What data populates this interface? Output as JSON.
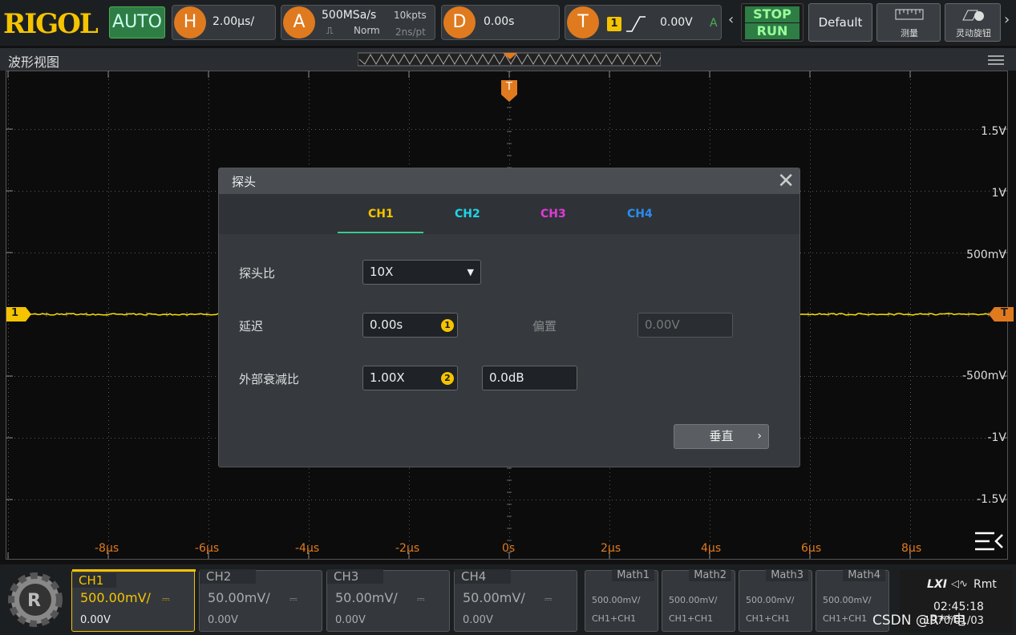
{
  "brand": {
    "logo": "RIGOL",
    "mode": "AUTO"
  },
  "horizontal": {
    "letter": "H",
    "timebase": "2.00μs/"
  },
  "acquire": {
    "letter": "A",
    "sample_rate": "500MSa/s",
    "depth": "10kpts",
    "acq_mode": "Norm",
    "interval": "2ns/pt"
  },
  "delay": {
    "letter": "D",
    "value": "0.00s"
  },
  "trigger": {
    "letter": "T",
    "source": "1",
    "level": "0.00V",
    "sweep": "A"
  },
  "buttons": {
    "stop": "STOP",
    "run": "RUN",
    "default": "Default",
    "measure": "测量",
    "multi_knob": "灵动旋钮"
  },
  "title_bar": {
    "title": "波形视图"
  },
  "y_axis_labels": [
    "1.5V",
    "1V",
    "500mV",
    "",
    "-500mV",
    "-1V",
    "-1.5V"
  ],
  "x_axis_labels": [
    "-8μs",
    "-6μs",
    "-4μs",
    "-2μs",
    "0s",
    "2μs",
    "4μs",
    "6μs",
    "8μs"
  ],
  "markers": {
    "ch1": "1",
    "trig": "T"
  },
  "dialog": {
    "title": "探头",
    "tabs": [
      {
        "label": "CH1",
        "color": "#f5c400"
      },
      {
        "label": "CH2",
        "color": "#21d4e8"
      },
      {
        "label": "CH3",
        "color": "#e03ad8"
      },
      {
        "label": "CH4",
        "color": "#2a8cf0"
      }
    ],
    "probe_ratio_label": "探头比",
    "probe_ratio_value": "10X",
    "delay_label": "延迟",
    "delay_value": "0.00s",
    "offset_label": "偏置",
    "offset_value": "0.00V",
    "atten_label": "外部衰减比",
    "atten_value": "1.00X",
    "atten_db": "0.0dB",
    "vertical_button": "垂直"
  },
  "channels": [
    {
      "name": "CH1",
      "scale": "500.00mV/",
      "offset": "0.00V",
      "color": "#f5c400"
    },
    {
      "name": "CH2",
      "scale": "50.00mV/",
      "offset": "0.00V",
      "color": "#888888"
    },
    {
      "name": "CH3",
      "scale": "50.00mV/",
      "offset": "0.00V",
      "color": "#888888"
    },
    {
      "name": "CH4",
      "scale": "50.00mV/",
      "offset": "0.00V",
      "color": "#888888"
    }
  ],
  "maths": [
    {
      "name": "Math1",
      "scale": "500.00mV/",
      "source": "CH1+CH1"
    },
    {
      "name": "Math2",
      "scale": "500.00mV/",
      "source": "CH1+CH1"
    },
    {
      "name": "Math3",
      "scale": "500.00mV/",
      "source": "CH1+CH1"
    },
    {
      "name": "Math4",
      "scale": "500.00mV/",
      "source": "CH1+CH1"
    }
  ],
  "status": {
    "lxi": "LXI",
    "sound": "◁∿",
    "rmt": "Rmt",
    "time": "02:45:18",
    "date": "1970/01/03"
  },
  "watermark": "CSDN @R**电"
}
